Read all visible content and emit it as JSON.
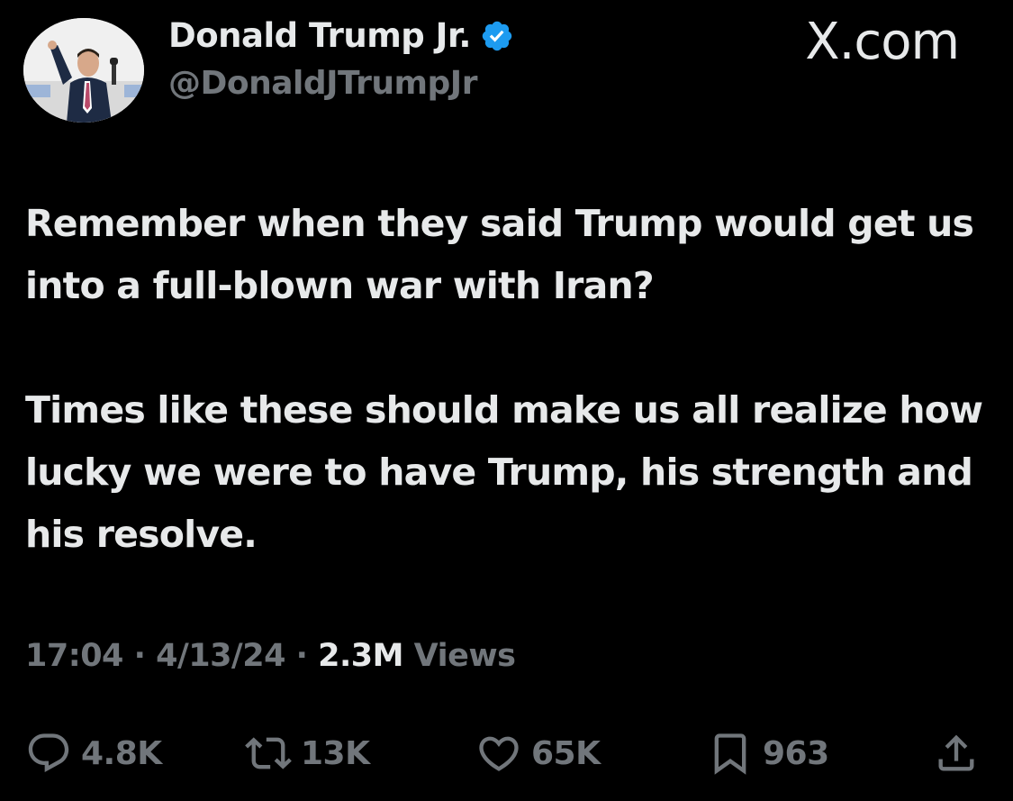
{
  "author": {
    "name": "Donald Trump Jr.",
    "handle": "@DonaldJTrumpJr",
    "verified_icon": "verified-badge-icon",
    "verified_color": "#1d9bf0"
  },
  "brand": "X.com",
  "tweet": {
    "paragraphs": [
      "Remember when they said Trump would get us into a full-blown war with Iran?",
      "Times like these should make us all realize how lucky we were to have Trump, his strength and his resolve."
    ]
  },
  "meta": {
    "time": "17:04",
    "separator": "·",
    "date": "4/13/24",
    "views_count": "2.3M",
    "views_label": "Views"
  },
  "actions": {
    "reply": {
      "icon": "reply-icon",
      "count": "4.8K"
    },
    "repost": {
      "icon": "repost-icon",
      "count": "13K"
    },
    "like": {
      "icon": "heart-icon",
      "count": "65K"
    },
    "bookmark": {
      "icon": "bookmark-icon",
      "count": "963"
    },
    "share": {
      "icon": "share-icon"
    }
  },
  "colors": {
    "background": "#000000",
    "primary_text": "#e7e9ea",
    "secondary_text": "#71767b"
  }
}
